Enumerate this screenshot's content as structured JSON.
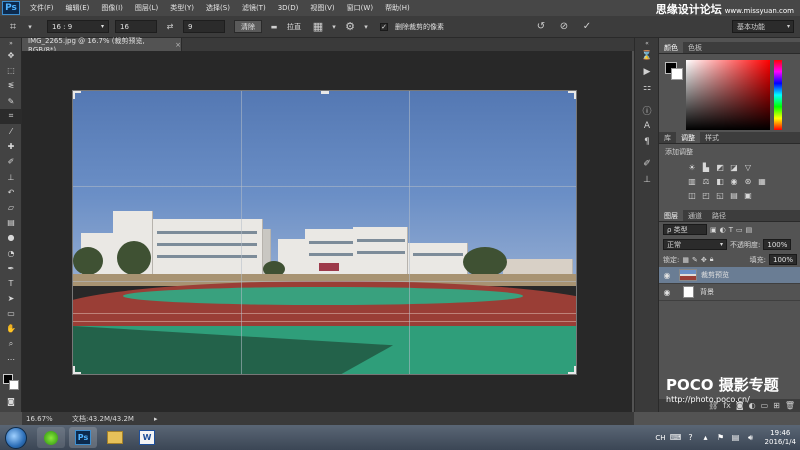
{
  "app": {
    "logo": "Ps",
    "menus": [
      "文件(F)",
      "编辑(E)",
      "图像(I)",
      "图层(L)",
      "类型(Y)",
      "选择(S)",
      "滤镜(T)",
      "3D(D)",
      "视图(V)",
      "窗口(W)",
      "帮助(H)"
    ],
    "watermark_title": "思缘设计论坛",
    "watermark_url": "www.missyuan.com"
  },
  "options": {
    "ratio_select": "16 : 9",
    "width_value": "16",
    "height_value": "9",
    "clear_button": "清除",
    "straighten_label": "拉直",
    "delete_cropped_label": "删除裁剪的像素",
    "workspace": "基本功能"
  },
  "document": {
    "tab_title": "IMG_2265.jpg @ 16.7% (裁剪预览, RGB/8*)",
    "close": "×"
  },
  "status": {
    "zoom": "16.67%",
    "doc_size": "文档:43.2M/43.2M",
    "arrow": "▸"
  },
  "panels": {
    "color_tabs": [
      "颜色",
      "色板"
    ],
    "adjust_tabs": [
      "库",
      "调整",
      "样式"
    ],
    "adjust_title": "添加调整",
    "layers_tabs": [
      "图层",
      "通道",
      "路径"
    ],
    "kind_select": "ρ 类型",
    "blend_mode": "正常",
    "opacity_label": "不透明度:",
    "opacity_value": "100%",
    "lock_label": "锁定:",
    "fill_label": "填充:",
    "fill_value": "100%",
    "layers": [
      {
        "name": "裁剪预览",
        "selected": true
      },
      {
        "name": "背景",
        "selected": false
      }
    ]
  },
  "watermark": {
    "brand": "POCO 摄影专题",
    "url": "http://photo.poco.cn/"
  },
  "taskbar": {
    "lang": "CH",
    "time": "19:46",
    "date": "2016/1/4"
  },
  "colors": {
    "accent_selected_layer": "#6a7d94",
    "foreground": "#000000",
    "background": "#ffffff"
  }
}
